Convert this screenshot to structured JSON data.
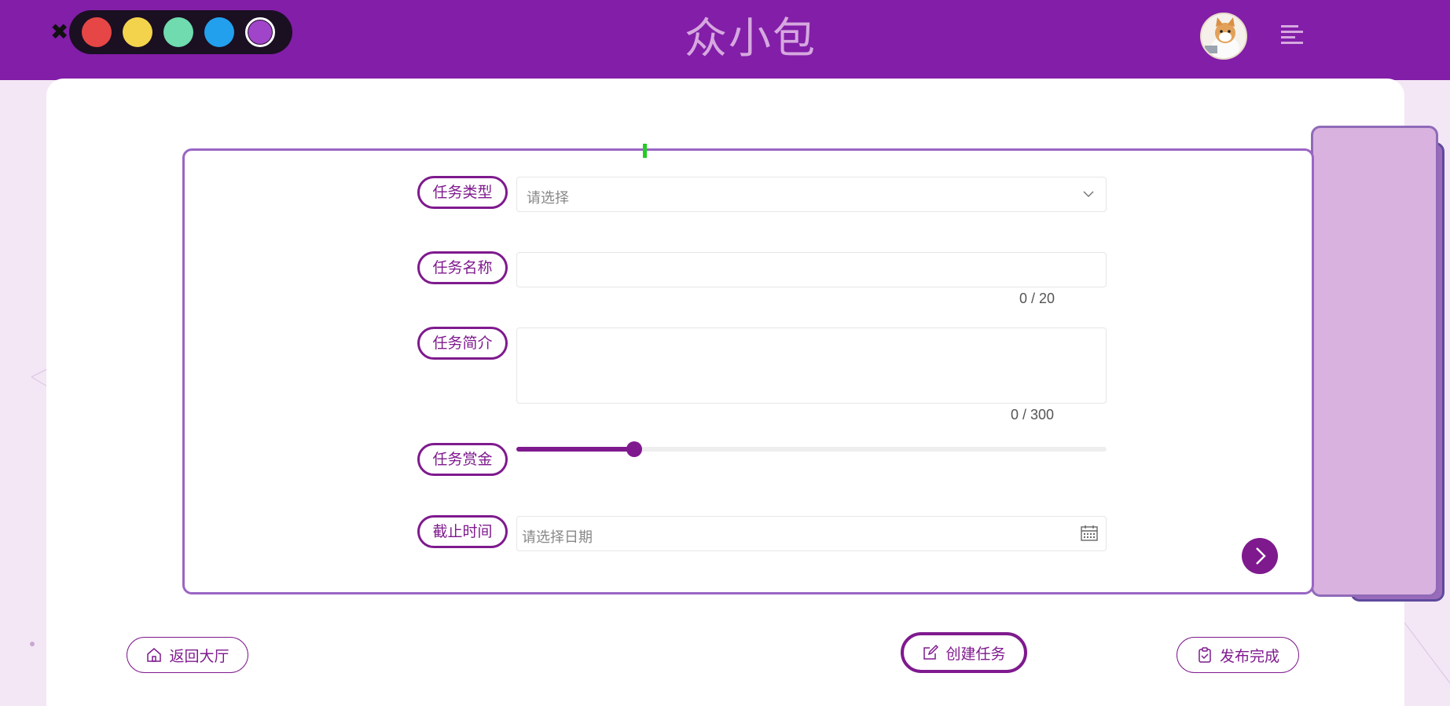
{
  "header": {
    "brand": "众小包",
    "close_glyph": "✖",
    "palette": [
      {
        "name": "red",
        "color": "#e64646"
      },
      {
        "name": "yellow",
        "color": "#f3d34b"
      },
      {
        "name": "green",
        "color": "#6fdbae"
      },
      {
        "name": "blue",
        "color": "#22a0ee"
      },
      {
        "name": "purple",
        "color": "#a044c9",
        "selected": true
      }
    ],
    "menu_icon": "align-left-icon",
    "avatar_icon": "cat-avatar"
  },
  "form": {
    "task_type": {
      "label": "任务类型",
      "placeholder": "请选择"
    },
    "task_name": {
      "label": "任务名称",
      "value": "",
      "counter": "0 / 20"
    },
    "task_desc": {
      "label": "任务简介",
      "value": "",
      "counter": "0 / 300"
    },
    "task_reward": {
      "label": "任务赏金",
      "level": 0.2
    },
    "deadline": {
      "label": "截止时间",
      "placeholder": "请选择日期"
    }
  },
  "footer": {
    "back_label": "返回大厅",
    "create_label": "创建任务",
    "publish_label": "发布完成"
  },
  "colors": {
    "header_bg": "#821ea8",
    "accent": "#7f1a8e"
  }
}
